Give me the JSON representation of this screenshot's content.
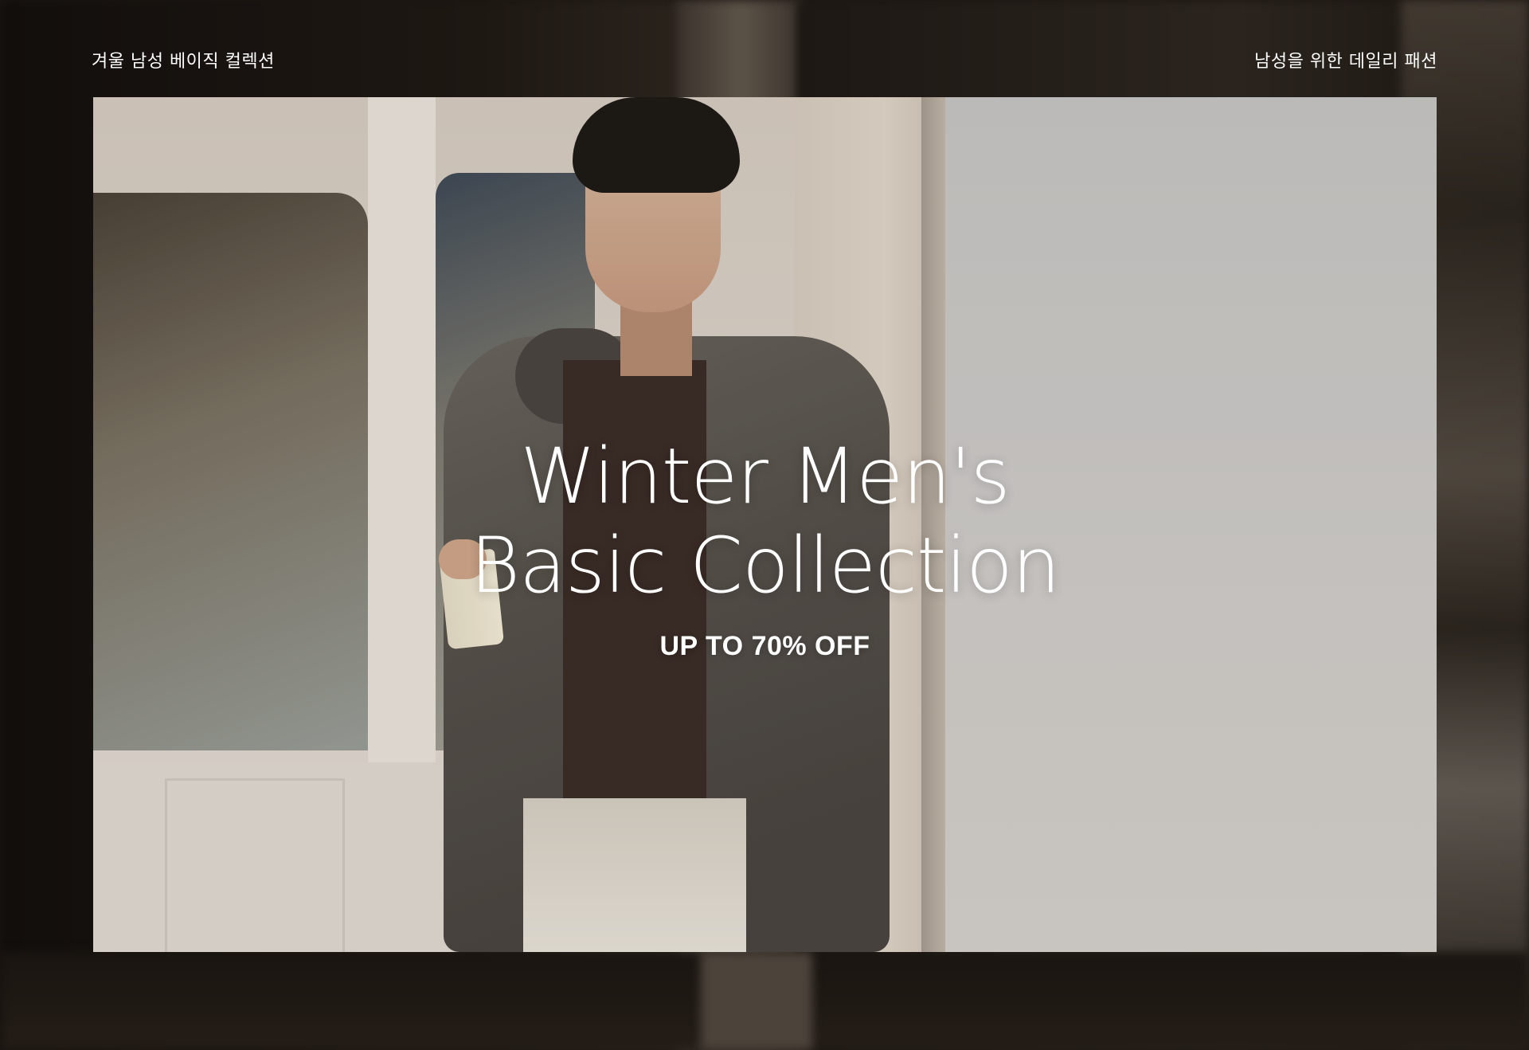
{
  "header": {
    "left_label": "겨울 남성 베이직 컬렉션",
    "right_label": "남성을 위한 데일리 패션"
  },
  "hero": {
    "title_line1": "Winter Men's",
    "title_line2": "Basic Collection",
    "subtitle": "UP TO 70% OFF"
  }
}
